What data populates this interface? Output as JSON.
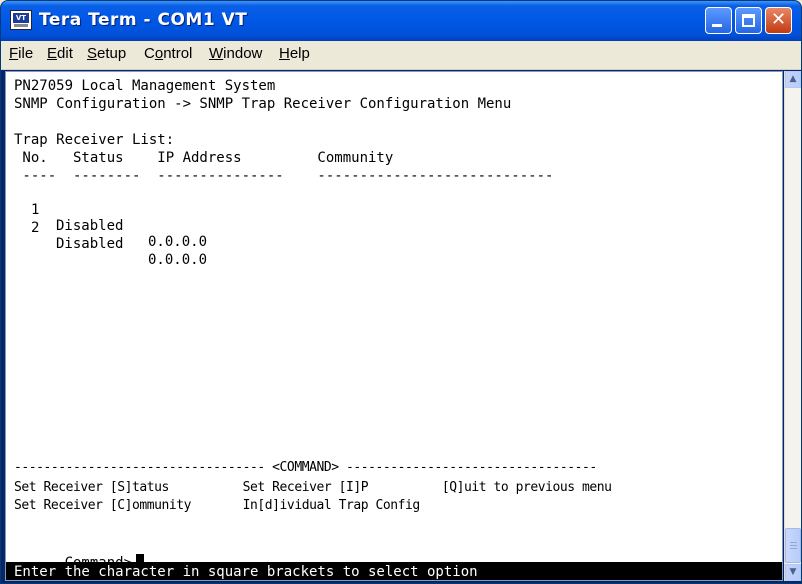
{
  "window": {
    "title": "Tera Term - COM1 VT",
    "icon_label": "VT",
    "close_glyph": "✕"
  },
  "menu": [
    {
      "label": "File",
      "mnemonic": "F"
    },
    {
      "label": "Edit",
      "mnemonic": "E"
    },
    {
      "label": "Setup",
      "mnemonic": "S"
    },
    {
      "label": "Control",
      "mnemonic": "o"
    },
    {
      "label": "Window",
      "mnemonic": "W"
    },
    {
      "label": "Help",
      "mnemonic": "H"
    }
  ],
  "terminal": {
    "system_title": "PN27059 Local Management System",
    "breadcrumb": "SNMP Configuration -> SNMP Trap Receiver Configuration Menu",
    "list_title": "Trap Receiver List:",
    "header_line": " No.   Status    IP Address         Community",
    "rule_line": " ----  --------  ---------------    ----------------------------",
    "rows": [
      {
        "no": "1",
        "status": "Disabled",
        "ip": "0.0.0.0",
        "community": ""
      },
      {
        "no": "2",
        "status": "Disabled",
        "ip": "0.0.0.0",
        "community": ""
      }
    ],
    "command_rule": "---------------------------------- <COMMAND> ----------------------------------",
    "options_line1": "Set Receiver [S]tatus          Set Receiver [I]P          [Q]uit to previous menu",
    "options_line2": "Set Receiver [C]ommunity       In[d]ividual Trap Config",
    "prompt": "Command>",
    "status_message": "Enter the character in square brackets to select option"
  },
  "colors": {
    "titlebar": "#0058e6",
    "terminal_bg": "#ffffff",
    "terminal_fg": "#000000",
    "status_bg": "#000000"
  },
  "scrollbar": {
    "up_glyph": "▲",
    "down_glyph": "▼"
  }
}
